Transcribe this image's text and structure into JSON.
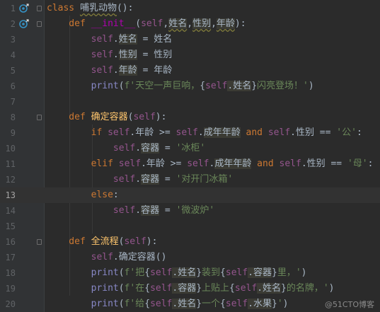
{
  "editor": {
    "current_line": 13,
    "lines": [
      {
        "n": "1",
        "tokens": [
          [
            "kw",
            "class "
          ],
          [
            "plain",
            "哺乳动物"
          ],
          [
            "plain",
            "():"
          ]
        ]
      },
      {
        "n": "2",
        "tokens": [
          [
            "kw",
            "    def "
          ],
          [
            "dund",
            "__init__"
          ],
          [
            "plain",
            "("
          ],
          [
            "slf",
            "self"
          ],
          [
            "plain",
            ","
          ],
          [
            "plain",
            "姓名"
          ],
          [
            "plain",
            ","
          ],
          [
            "plain",
            "性别"
          ],
          [
            "plain",
            ","
          ],
          [
            "plain",
            "年龄"
          ],
          [
            "plain",
            "):"
          ]
        ]
      },
      {
        "n": "3",
        "tokens": [
          [
            "slf",
            "        self"
          ],
          [
            "plain",
            "."
          ],
          [
            "plain",
            "姓名"
          ],
          [
            "plain",
            " = 姓名"
          ]
        ]
      },
      {
        "n": "4",
        "tokens": [
          [
            "slf",
            "        self"
          ],
          [
            "plain",
            "."
          ],
          [
            "plain",
            "性别"
          ],
          [
            "plain",
            " = 性别"
          ]
        ]
      },
      {
        "n": "5",
        "tokens": [
          [
            "slf",
            "        self"
          ],
          [
            "plain",
            "."
          ],
          [
            "plain",
            "年龄"
          ],
          [
            "plain",
            " = 年龄"
          ]
        ]
      },
      {
        "n": "6",
        "tokens": [
          [
            "bi",
            "        print"
          ],
          [
            "plain",
            "("
          ],
          [
            "str",
            "f'天空一声巨响，"
          ],
          [
            "plain",
            "{"
          ],
          [
            "slf",
            "self"
          ],
          [
            "plain",
            ".姓名"
          ],
          [
            "plain",
            "}"
          ],
          [
            "str",
            "闪亮登场！'"
          ],
          [
            "plain",
            ")"
          ]
        ]
      },
      {
        "n": "7",
        "tokens": []
      },
      {
        "n": "8",
        "tokens": [
          [
            "kw",
            "    def "
          ],
          [
            "fn",
            "确定容器"
          ],
          [
            "plain",
            "("
          ],
          [
            "slf",
            "self"
          ],
          [
            "plain",
            "):"
          ]
        ]
      },
      {
        "n": "9",
        "tokens": [
          [
            "kw",
            "        if "
          ],
          [
            "slf",
            "self"
          ],
          [
            "plain",
            ".年龄 >= "
          ],
          [
            "slf",
            "self"
          ],
          [
            "plain",
            "."
          ],
          [
            "plain",
            "成年年龄"
          ],
          [
            "kw",
            " and "
          ],
          [
            "slf",
            "self"
          ],
          [
            "plain",
            ".性别 == "
          ],
          [
            "str",
            "'公'"
          ],
          [
            "plain",
            ":"
          ]
        ]
      },
      {
        "n": "10",
        "tokens": [
          [
            "slf",
            "            self"
          ],
          [
            "plain",
            "."
          ],
          [
            "plain",
            "容器"
          ],
          [
            "plain",
            " = "
          ],
          [
            "str",
            "'冰柜'"
          ]
        ]
      },
      {
        "n": "11",
        "tokens": [
          [
            "kw",
            "        elif "
          ],
          [
            "slf",
            "self"
          ],
          [
            "plain",
            ".年龄 >= "
          ],
          [
            "slf",
            "self"
          ],
          [
            "plain",
            "."
          ],
          [
            "plain",
            "成年年龄"
          ],
          [
            "kw",
            " and "
          ],
          [
            "slf",
            "self"
          ],
          [
            "plain",
            ".性别 == "
          ],
          [
            "str",
            "'母'"
          ],
          [
            "plain",
            ":"
          ]
        ]
      },
      {
        "n": "12",
        "tokens": [
          [
            "slf",
            "            self"
          ],
          [
            "plain",
            "."
          ],
          [
            "plain",
            "容器"
          ],
          [
            "plain",
            " = "
          ],
          [
            "str",
            "'对开门冰箱'"
          ]
        ]
      },
      {
        "n": "13",
        "tokens": [
          [
            "kw",
            "        else"
          ],
          [
            "plain",
            ":"
          ]
        ]
      },
      {
        "n": "14",
        "tokens": [
          [
            "slf",
            "            self"
          ],
          [
            "plain",
            "."
          ],
          [
            "plain",
            "容器"
          ],
          [
            "plain",
            " = "
          ],
          [
            "str",
            "'微波炉'"
          ]
        ]
      },
      {
        "n": "15",
        "tokens": []
      },
      {
        "n": "16",
        "tokens": [
          [
            "kw",
            "    def "
          ],
          [
            "fn",
            "全流程"
          ],
          [
            "plain",
            "("
          ],
          [
            "slf",
            "self"
          ],
          [
            "plain",
            "):"
          ]
        ]
      },
      {
        "n": "17",
        "tokens": [
          [
            "slf",
            "        self"
          ],
          [
            "plain",
            ".确定容器()"
          ]
        ]
      },
      {
        "n": "18",
        "tokens": [
          [
            "bi",
            "        print"
          ],
          [
            "plain",
            "("
          ],
          [
            "str",
            "f'把"
          ],
          [
            "plain",
            "{"
          ],
          [
            "slf",
            "self"
          ],
          [
            "plain",
            ".姓名"
          ],
          [
            "plain",
            "}"
          ],
          [
            "str",
            "装到"
          ],
          [
            "plain",
            "{"
          ],
          [
            "slf",
            "self"
          ],
          [
            "plain",
            ".容器"
          ],
          [
            "plain",
            "}"
          ],
          [
            "str",
            "里，'"
          ],
          [
            "plain",
            ")"
          ]
        ]
      },
      {
        "n": "19",
        "tokens": [
          [
            "bi",
            "        print"
          ],
          [
            "plain",
            "("
          ],
          [
            "str",
            "f'在"
          ],
          [
            "plain",
            "{"
          ],
          [
            "slf",
            "self"
          ],
          [
            "plain",
            ".容器"
          ],
          [
            "plain",
            "}"
          ],
          [
            "str",
            "上贴上"
          ],
          [
            "plain",
            "{"
          ],
          [
            "slf",
            "self"
          ],
          [
            "plain",
            ".姓名"
          ],
          [
            "plain",
            "}"
          ],
          [
            "str",
            "的名牌，'"
          ],
          [
            "plain",
            ")"
          ]
        ]
      },
      {
        "n": "20",
        "tokens": [
          [
            "bi",
            "        print"
          ],
          [
            "plain",
            "("
          ],
          [
            "str",
            "f'给"
          ],
          [
            "plain",
            "{"
          ],
          [
            "slf",
            "self"
          ],
          [
            "plain",
            ".姓名"
          ],
          [
            "plain",
            "}"
          ],
          [
            "str",
            "一个"
          ],
          [
            "plain",
            "{"
          ],
          [
            "slf",
            "self"
          ],
          [
            "plain",
            ".水果"
          ],
          [
            "plain",
            "}"
          ],
          [
            "str",
            "'"
          ],
          [
            "plain",
            ")"
          ]
        ]
      }
    ]
  },
  "watermark": "@51CTO博客"
}
